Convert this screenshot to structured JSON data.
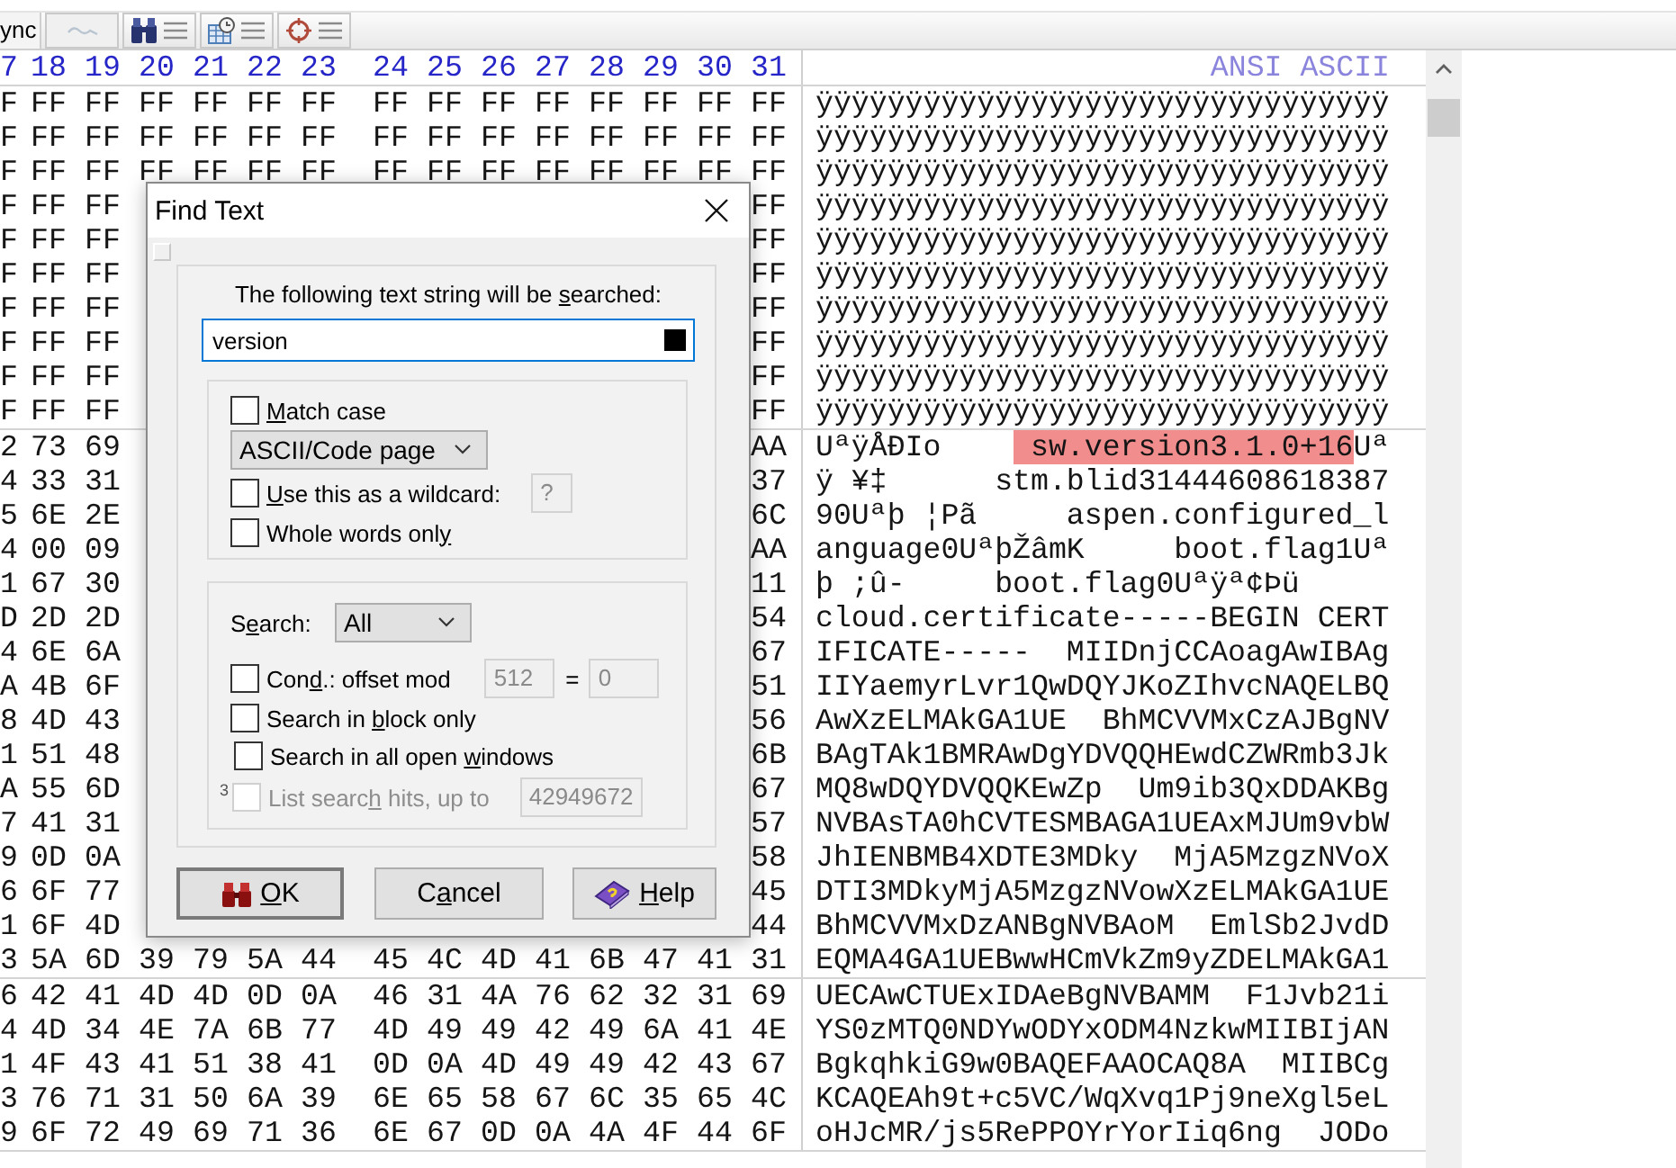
{
  "toolbar": {
    "tab": "ync",
    "buttons": [
      {
        "kind": "wave",
        "disabled": true
      },
      {
        "kind": "find",
        "disabled": false
      },
      {
        "kind": "date",
        "disabled": false
      },
      {
        "kind": "target",
        "disabled": false
      }
    ]
  },
  "editor": {
    "columns": [
      "7",
      "18",
      "19",
      "20",
      "21",
      "22",
      "23",
      "24",
      "25",
      "26",
      "27",
      "28",
      "29",
      "30",
      "31"
    ],
    "text_header": "ANSI ASCII",
    "blocks": [
      [
        {
          "hex": [
            "F",
            "FF",
            "FF",
            "FF",
            "FF",
            "FF",
            "FF",
            "FF",
            "FF",
            "FF",
            "FF",
            "FF",
            "FF",
            "FF",
            "FF"
          ],
          "ascii": [
            {
              "text": "ÿÿÿÿÿÿÿÿÿÿÿÿÿÿÿÿÿÿÿÿÿÿÿÿÿÿÿÿÿÿÿÿ",
              "selected": false
            }
          ]
        },
        {
          "hex": [
            "F",
            "FF",
            "FF",
            "FF",
            "FF",
            "FF",
            "FF",
            "FF",
            "FF",
            "FF",
            "FF",
            "FF",
            "FF",
            "FF",
            "FF"
          ],
          "ascii": [
            {
              "text": "ÿÿÿÿÿÿÿÿÿÿÿÿÿÿÿÿÿÿÿÿÿÿÿÿÿÿÿÿÿÿÿÿ",
              "selected": false
            }
          ]
        },
        {
          "hex": [
            "F",
            "FF",
            "FF",
            "FF",
            "FF",
            "FF",
            "FF",
            "FF",
            "FF",
            "FF",
            "FF",
            "FF",
            "FF",
            "FF",
            "FF"
          ],
          "ascii": [
            {
              "text": "ÿÿÿÿÿÿÿÿÿÿÿÿÿÿÿÿÿÿÿÿÿÿÿÿÿÿÿÿÿÿÿÿ",
              "selected": false
            }
          ]
        },
        {
          "hex": [
            "F",
            "FF",
            "FF",
            "FF"
          ],
          "ascii": [
            {
              "text": "ÿÿÿÿÿÿÿÿÿÿÿÿÿÿÿÿÿÿÿÿÿÿÿÿÿÿÿÿÿÿÿÿ",
              "selected": false
            }
          ]
        },
        {
          "hex": [
            "F",
            "FF",
            "FF",
            "FF"
          ],
          "ascii": [
            {
              "text": "ÿÿÿÿÿÿÿÿÿÿÿÿÿÿÿÿÿÿÿÿÿÿÿÿÿÿÿÿÿÿÿÿ",
              "selected": false
            }
          ]
        },
        {
          "hex": [
            "F",
            "FF",
            "FF",
            "FF"
          ],
          "ascii": [
            {
              "text": "ÿÿÿÿÿÿÿÿÿÿÿÿÿÿÿÿÿÿÿÿÿÿÿÿÿÿÿÿÿÿÿÿ",
              "selected": false
            }
          ]
        },
        {
          "hex": [
            "F",
            "FF",
            "FF",
            "FF"
          ],
          "ascii": [
            {
              "text": "ÿÿÿÿÿÿÿÿÿÿÿÿÿÿÿÿÿÿÿÿÿÿÿÿÿÿÿÿÿÿÿÿ",
              "selected": false
            }
          ]
        },
        {
          "hex": [
            "F",
            "FF",
            "FF",
            "FF"
          ],
          "ascii": [
            {
              "text": "ÿÿÿÿÿÿÿÿÿÿÿÿÿÿÿÿÿÿÿÿÿÿÿÿÿÿÿÿÿÿÿÿ",
              "selected": false
            }
          ]
        },
        {
          "hex": [
            "F",
            "FF",
            "FF",
            "FF"
          ],
          "ascii": [
            {
              "text": "ÿÿÿÿÿÿÿÿÿÿÿÿÿÿÿÿÿÿÿÿÿÿÿÿÿÿÿÿÿÿÿÿ",
              "selected": false
            }
          ]
        },
        {
          "hex": [
            "F",
            "FF",
            "FF",
            "FF"
          ],
          "ascii": [
            {
              "text": "ÿÿÿÿÿÿÿÿÿÿÿÿÿÿÿÿÿÿÿÿÿÿÿÿÿÿÿÿÿÿÿÿ",
              "selected": false
            }
          ]
        }
      ],
      [
        {
          "hex": [
            "2",
            "73",
            "69",
            "AA"
          ],
          "ascii": [
            {
              "text": "UªÿÅÐIo    ",
              "selected": false
            },
            {
              "text": " sw.version3.1.0+16",
              "selected": true
            },
            {
              "text": "Uª",
              "selected": false
            }
          ]
        },
        {
          "hex": [
            "4",
            "33",
            "31",
            "37"
          ],
          "ascii": [
            {
              "text": "ÿ ¥‡      stm.blid31444608618387",
              "selected": false
            }
          ]
        },
        {
          "hex": [
            "5",
            "6E",
            "2E",
            "6C"
          ],
          "ascii": [
            {
              "text": "90Uªþ ¦Pã     aspen.configured_l",
              "selected": false
            }
          ]
        },
        {
          "hex": [
            "4",
            "00",
            "09",
            "AA"
          ],
          "ascii": [
            {
              "text": "anguage0UªþŽâmK     boot.flag1Uª",
              "selected": false
            }
          ]
        },
        {
          "hex": [
            "1",
            "67",
            "30",
            "11"
          ],
          "ascii": [
            {
              "text": "þ ;û-     boot.flag0Uªÿª¢Þü",
              "selected": false
            }
          ]
        },
        {
          "hex": [
            "D",
            "2D",
            "2D",
            "54"
          ],
          "ascii": [
            {
              "text": "cloud.certificate-----BEGIN CERT",
              "selected": false
            }
          ]
        },
        {
          "hex": [
            "4",
            "6E",
            "6A",
            "67"
          ],
          "ascii": [
            {
              "text": "IFICATE-----  MIIDnjCCAoagAwIBAg",
              "selected": false
            }
          ]
        },
        {
          "hex": [
            "A",
            "4B",
            "6F",
            "51"
          ],
          "ascii": [
            {
              "text": "IIYaemyrLvr1QwDQYJKoZIhvcNAQELBQ",
              "selected": false
            }
          ]
        },
        {
          "hex": [
            "8",
            "4D",
            "43",
            "56"
          ],
          "ascii": [
            {
              "text": "AwXzELMAkGA1UE  BhMCVVMxCzAJBgNV",
              "selected": false
            }
          ]
        },
        {
          "hex": [
            "1",
            "51",
            "48",
            "6B"
          ],
          "ascii": [
            {
              "text": "BAgTAk1BMRAwDgYDVQQHEwdCZWRmb3Jk",
              "selected": false
            }
          ]
        },
        {
          "hex": [
            "A",
            "55",
            "6D",
            "67"
          ],
          "ascii": [
            {
              "text": "MQ8wDQYDVQQKEwZp  Um9ib3QxDDAKBg",
              "selected": false
            }
          ]
        },
        {
          "hex": [
            "7",
            "41",
            "31",
            "57"
          ],
          "ascii": [
            {
              "text": "NVBAsTA0hCVTESMBAGA1UEAxMJUm9vbW",
              "selected": false
            }
          ]
        },
        {
          "hex": [
            "9",
            "0D",
            "0A",
            "58"
          ],
          "ascii": [
            {
              "text": "JhIENBMB4XDTE3MDky  MjA5MzgzNVoX",
              "selected": false
            }
          ]
        },
        {
          "hex": [
            "6",
            "6F",
            "77",
            "45"
          ],
          "ascii": [
            {
              "text": "DTI3MDkyMjA5MzgzNVowXzELMAkGA1UE",
              "selected": false
            }
          ]
        },
        {
          "hex": [
            "1",
            "6F",
            "4D",
            "44"
          ],
          "ascii": [
            {
              "text": "BhMCVVMxDzANBgNVBAoM  EmlSb2JvdD",
              "selected": false
            }
          ]
        },
        {
          "hex": [
            "3",
            "5A",
            "6D",
            "39",
            "79",
            "5A",
            "44",
            "45",
            "4C",
            "4D",
            "41",
            "6B",
            "47",
            "41",
            "31"
          ],
          "ascii": [
            {
              "text": "EQMA4GA1UEBwwHCmVkZm9yZDELMAkGA1",
              "selected": false
            }
          ]
        }
      ],
      [
        {
          "hex": [
            "6",
            "42",
            "41",
            "4D",
            "4D",
            "0D",
            "0A",
            "46",
            "31",
            "4A",
            "76",
            "62",
            "32",
            "31",
            "69"
          ],
          "ascii": [
            {
              "text": "UECAwCTUExIDAeBgNVBAMM  F1Jvb21i",
              "selected": false
            }
          ]
        },
        {
          "hex": [
            "4",
            "4D",
            "34",
            "4E",
            "7A",
            "6B",
            "77",
            "4D",
            "49",
            "49",
            "42",
            "49",
            "6A",
            "41",
            "4E"
          ],
          "ascii": [
            {
              "text": "YS0zMTQ0NDYwODYxODM4NzkwMIIBIjAN",
              "selected": false
            }
          ]
        },
        {
          "hex": [
            "1",
            "4F",
            "43",
            "41",
            "51",
            "38",
            "41",
            "0D",
            "0A",
            "4D",
            "49",
            "49",
            "42",
            "43",
            "67"
          ],
          "ascii": [
            {
              "text": "BgkqhkiG9w0BAQEFAAOCAQ8A  MIIBCg",
              "selected": false
            }
          ]
        },
        {
          "hex": [
            "3",
            "76",
            "71",
            "31",
            "50",
            "6A",
            "39",
            "6E",
            "65",
            "58",
            "67",
            "6C",
            "35",
            "65",
            "4C"
          ],
          "ascii": [
            {
              "text": "KCAQEAh9t+c5VC/WqXvq1Pj9neXgl5eL",
              "selected": false
            }
          ]
        },
        {
          "hex": [
            "9",
            "6F",
            "72",
            "49",
            "69",
            "71",
            "36",
            "6E",
            "67",
            "0D",
            "0A",
            "4A",
            "4F",
            "44",
            "6F"
          ],
          "ascii": [
            {
              "text": "oHJcMR/js5RePPOYrYorIiq6ng  JODo",
              "selected": false
            }
          ]
        }
      ]
    ]
  },
  "dialog": {
    "title": "Find Text",
    "prompt": [
      {
        "text": "The following text string will be ",
        "underline": false
      },
      {
        "text": "s",
        "underline": true
      },
      {
        "text": "earched:",
        "underline": false
      }
    ],
    "search_text": "version",
    "match_case": {
      "label": [
        {
          "text": "M",
          "underline": true
        },
        {
          "text": "atch case",
          "underline": false
        }
      ],
      "checked": false,
      "disabled": false
    },
    "encoding": "ASCII/Code page",
    "wildcard": {
      "label": [
        {
          "text": "U",
          "underline": true
        },
        {
          "text": "se this as a wildcard:",
          "underline": false
        }
      ],
      "checked": false,
      "disabled": false,
      "field": {
        "value": "?",
        "disabled": true
      }
    },
    "whole_words": {
      "label": [
        {
          "text": "Whole words onl",
          "underline": false
        },
        {
          "text": "y",
          "underline": true
        }
      ],
      "checked": false,
      "disabled": false
    },
    "search": {
      "label": [
        {
          "text": "S",
          "underline": false
        },
        {
          "text": "e",
          "underline": true
        },
        {
          "text": "arch:",
          "underline": false
        }
      ],
      "value": "All"
    },
    "condition": {
      "label": [
        {
          "text": "Con",
          "underline": false
        },
        {
          "text": "d",
          "underline": true
        },
        {
          "text": ".: offset mod",
          "underline": false
        }
      ],
      "checked": false,
      "disabled": false,
      "modulus": {
        "value": "512",
        "disabled": true
      },
      "equals": "=",
      "remainder": {
        "value": "0",
        "disabled": true
      }
    },
    "block_only": {
      "label": [
        {
          "text": "Search in ",
          "underline": false
        },
        {
          "text": "b",
          "underline": true
        },
        {
          "text": "lock only",
          "underline": false
        }
      ],
      "checked": false,
      "disabled": false
    },
    "all_windows": {
      "label": [
        {
          "text": "Search in all open ",
          "underline": false
        },
        {
          "text": "w",
          "underline": true
        },
        {
          "text": "indows",
          "underline": false
        }
      ],
      "checked": false,
      "disabled": false
    },
    "list_hits": {
      "note": "3",
      "label": [
        {
          "text": "List searc",
          "underline": false
        },
        {
          "text": "h",
          "underline": true
        },
        {
          "text": " hits, up to",
          "underline": false
        }
      ],
      "checked": false,
      "disabled": true,
      "field": {
        "value": "42949672",
        "disabled": true
      }
    },
    "buttons": [
      {
        "kind": "ok",
        "label": [
          {
            "text": "O",
            "underline": true
          },
          {
            "text": "K",
            "underline": false
          }
        ]
      },
      {
        "kind": "cancel",
        "label": [
          {
            "text": "C",
            "underline": false
          },
          {
            "text": "a",
            "underline": true
          },
          {
            "text": "ncel",
            "underline": false
          }
        ]
      },
      {
        "kind": "help",
        "label": [
          {
            "text": "H",
            "underline": true
          },
          {
            "text": "elp",
            "underline": false
          }
        ]
      }
    ]
  }
}
